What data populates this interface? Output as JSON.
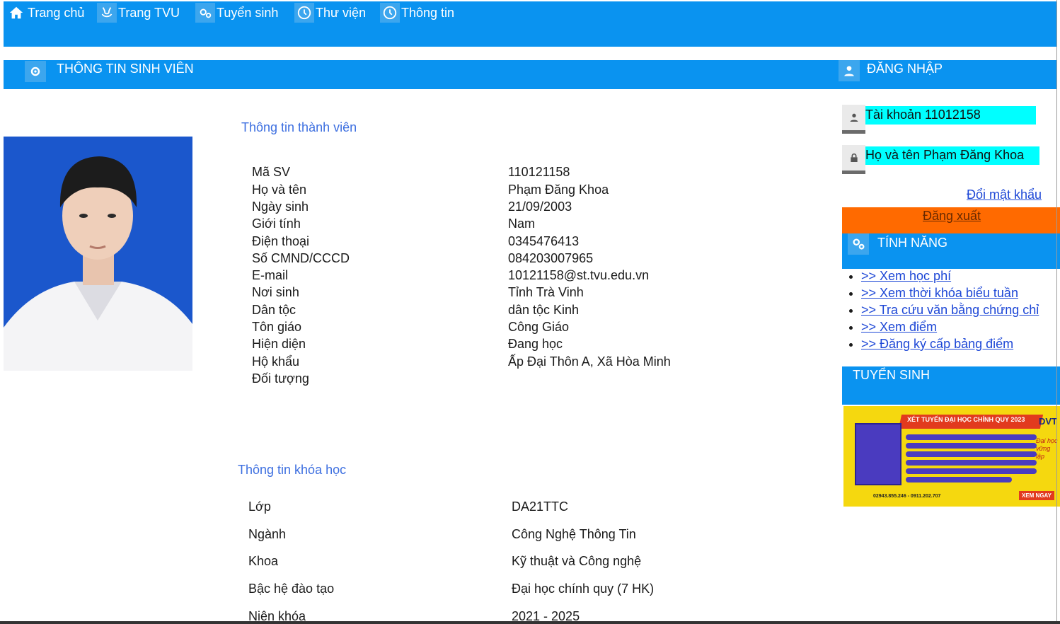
{
  "nav": {
    "home": "Trang chủ",
    "tvu": "Trang TVU",
    "admission": "Tuyển sinh",
    "library": "Thư viện",
    "info": "Thông tin"
  },
  "student_header": "THÔNG TIN SINH VIÊN",
  "login_header": "ĐĂNG NHẬP",
  "member": {
    "title": "Thông tin thành viên",
    "rows": [
      {
        "label": "Mã SV",
        "value": "110121158"
      },
      {
        "label": "Họ và tên",
        "value": "Phạm Đăng Khoa"
      },
      {
        "label": "Ngày sinh",
        "value": "21/09/2003"
      },
      {
        "label": "Giới tính",
        "value": "Nam"
      },
      {
        "label": "Điện thoại",
        "value": "0345476413"
      },
      {
        "label": "Số CMND/CCCD",
        "value": "084203007965"
      },
      {
        "label": "E-mail",
        "value": "10121158@st.tvu.edu.vn"
      },
      {
        "label": "Nơi sinh",
        "value": "Tỉnh Trà Vinh"
      },
      {
        "label": "Dân tộc",
        "value": "dân tộc Kinh"
      },
      {
        "label": "Tôn giáo",
        "value": "Công Giáo"
      },
      {
        "label": "Hiện diện",
        "value": "Đang học"
      },
      {
        "label": "Hộ khẩu",
        "value": "Ấp Đại Thôn A, Xã Hòa Minh"
      },
      {
        "label": "Đối tượng",
        "value": ""
      }
    ]
  },
  "course": {
    "title": "Thông tin khóa học",
    "rows": [
      {
        "label": "Lớp",
        "value": "DA21TTC"
      },
      {
        "label": "Ngành",
        "value": "Công Nghệ Thông Tin"
      },
      {
        "label": "Khoa",
        "value": "Kỹ thuật và Công nghệ"
      },
      {
        "label": "Bậc hệ đào tạo",
        "value": "Đại học chính quy (7 HK)"
      },
      {
        "label": "Niên khóa",
        "value": "2021 - 2025"
      }
    ]
  },
  "account": {
    "username": "Tài khoản 11012158",
    "fullname": "Họ và tên Phạm Đăng Khoa",
    "change_password": "Đổi mật khẩu",
    "logout": "Đăng xuất"
  },
  "features": {
    "title": "TÍNH NĂNG",
    "items": [
      ">> Xem học phí",
      ">> Xem thời khóa biểu tuần",
      ">> Tra cứu văn bằng chứng chỉ",
      ">> Xem điểm",
      ">> Đăng ký cấp bảng điểm"
    ]
  },
  "admission_box": {
    "title": "TUYỂN SINH",
    "banner": {
      "headline": "XÉT TUYỂN ĐẠI HỌC CHÍNH QUY 2023",
      "school": "DVT",
      "slogan": "Đại học vững lập",
      "phone": "02943.855.246 - 0911.202.707",
      "cta": "XEM NGAY"
    }
  },
  "colors": {
    "primary": "#0a93f0",
    "accent_orange": "#ff6a00",
    "field_bg": "#00ffff",
    "link": "#1d47d6",
    "section_title": "#3d6fe0"
  }
}
